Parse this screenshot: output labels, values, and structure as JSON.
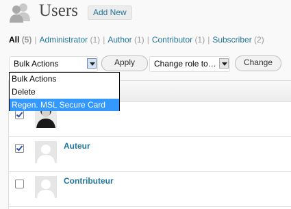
{
  "header": {
    "title": "Users",
    "add_new_label": "Add New"
  },
  "filters": [
    {
      "label": "All",
      "count": "(5)",
      "current": true
    },
    {
      "label": "Administrator",
      "count": "(1)"
    },
    {
      "label": "Author",
      "count": "(1)"
    },
    {
      "label": "Contributor",
      "count": "(1)"
    },
    {
      "label": "Subscriber",
      "count": "(2)"
    }
  ],
  "bulk_actions": {
    "selected": "Bulk Actions",
    "options": [
      "Bulk Actions",
      "Delete",
      "Regen. MSL Secure Card"
    ],
    "highlighted_option": "Regen. MSL Secure Card",
    "apply_label": "Apply"
  },
  "change_role": {
    "selected": "Change role to…",
    "button_label": "Change"
  },
  "users": [
    {
      "username": "",
      "checked": true,
      "avatar": "photo"
    },
    {
      "username": "Auteur",
      "checked": true,
      "avatar": "default"
    },
    {
      "username": "Contributeur",
      "checked": false,
      "avatar": "default"
    }
  ],
  "colors": {
    "link": "#21759b",
    "highlight": "#3399ff"
  }
}
